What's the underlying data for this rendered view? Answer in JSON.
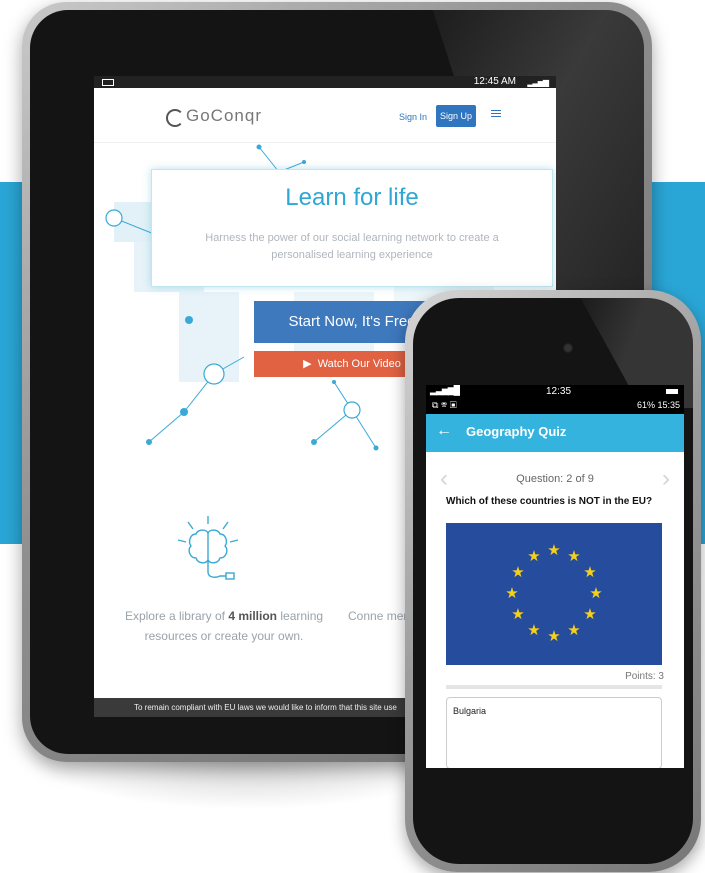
{
  "colors": {
    "banner": "#2aa6d6",
    "primary": "#3e78bd",
    "video": "#e06242",
    "appbar": "#34b3df",
    "flag_blue": "#254c9d",
    "flag_star": "#f5cf1c"
  },
  "tablet": {
    "status_time": "12:45 AM",
    "logo_text": "GoConqr",
    "sign_in": "Sign In",
    "sign_up": "Sign Up",
    "hero_title": "Learn for life",
    "hero_subtitle": "Harness the power of our social learning network to create a personalised learning experience",
    "start_button": "Start Now, It's Free",
    "video_button": "Watch Our Video",
    "explore_prefix": "Explore a library of ",
    "explore_bold": "4 million",
    "explore_suffix": " learning resources or create your own.",
    "connect_text": "Conne membe",
    "cookie_text": "To remain compliant with EU laws we would like to inform that this site use"
  },
  "phone": {
    "status_time_top": "12:35",
    "status_right": "61% 15:35",
    "app_title": "Geography Quiz",
    "question_counter": "Question: 2 of 9",
    "question_text": "Which of these countries is NOT in the EU?",
    "points": "Points: 3",
    "answer": "Bulgaria",
    "icons": [
      "back-arrow-icon",
      "chevron-left-icon",
      "chevron-right-icon",
      "eu-flag-icon"
    ]
  }
}
